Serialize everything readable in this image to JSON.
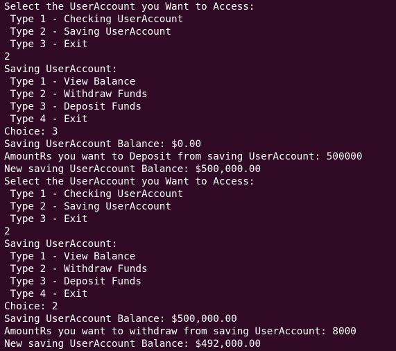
{
  "terminal": {
    "background": "#300a24",
    "foreground": "#ffffff",
    "lines": [
      "Select the UserAccount you Want to Access:",
      " Type 1 - Checking UserAccount",
      " Type 2 - Saving UserAccount",
      " Type 3 - Exit",
      "2",
      "Saving UserAccount:",
      " Type 1 - View Balance",
      " Type 2 - Withdraw Funds",
      " Type 3 - Deposit Funds",
      " Type 4 - Exit",
      "Choice: 3",
      "Saving UserAccount Balance: $0.00",
      "AmountRs you want to Deposit from saving UserAccount: 500000",
      "New saving UserAccount Balance: $500,000.00",
      "Select the UserAccount you Want to Access:",
      " Type 1 - Checking UserAccount",
      " Type 2 - Saving UserAccount",
      " Type 3 - Exit",
      "2",
      "Saving UserAccount:",
      " Type 1 - View Balance",
      " Type 2 - Withdraw Funds",
      " Type 3 - Deposit Funds",
      " Type 4 - Exit",
      "Choice: 2",
      "Saving UserAccount Balance: $500,000.00",
      "AmountRs you want to withdraw from saving UserAccount: 8000",
      "New saving UserAccount Balance: $492,000.00"
    ]
  }
}
